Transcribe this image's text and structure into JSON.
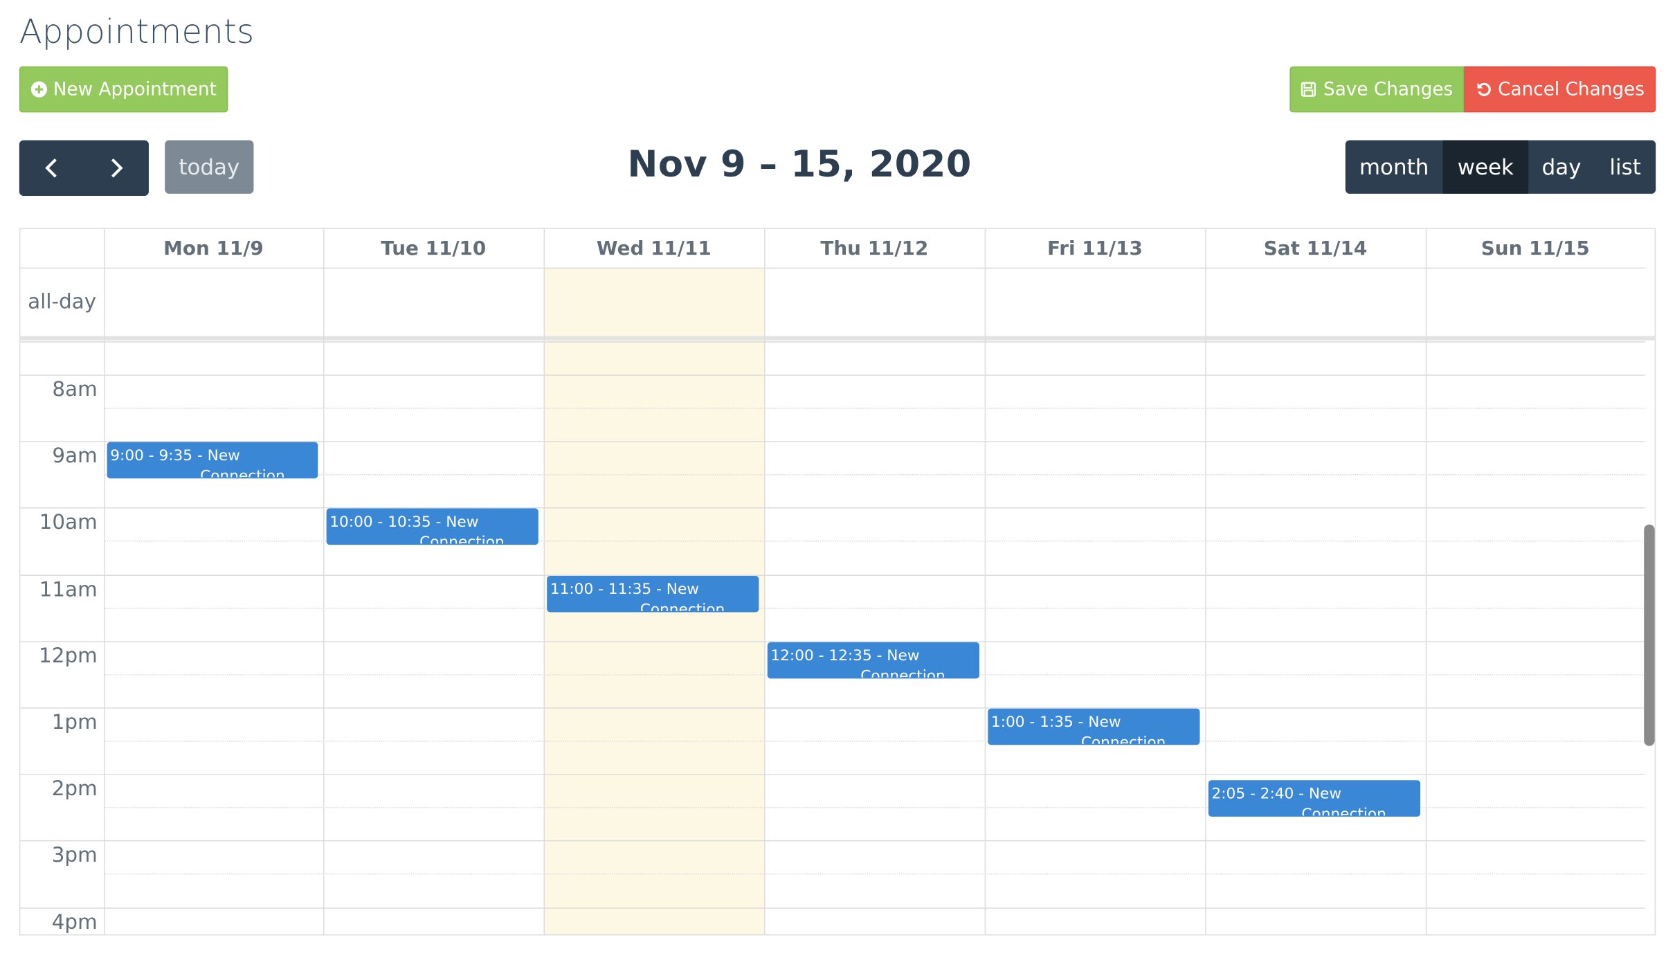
{
  "page": {
    "title": "Appointments"
  },
  "toolbar": {
    "new_label": "New Appointment",
    "save_label": "Save Changes",
    "cancel_label": "Cancel Changes",
    "today_label": "today",
    "range": "Nov 9 – 15, 2020",
    "views": [
      "month",
      "week",
      "day",
      "list"
    ],
    "active_view": "week"
  },
  "calendar": {
    "days": [
      "Mon 11/9",
      "Tue 11/10",
      "Wed 11/11",
      "Thu 11/12",
      "Fri 11/13",
      "Sat 11/14",
      "Sun 11/15"
    ],
    "today_index": 2,
    "allday_label": "all-day",
    "hours": [
      "8am",
      "9am",
      "10am",
      "11am",
      "12pm",
      "1pm",
      "2pm",
      "3pm",
      "4pm"
    ],
    "events": [
      {
        "day": 0,
        "time": "9:00 - 9:35",
        "title": "New Connection"
      },
      {
        "day": 1,
        "time": "10:00 - 10:35",
        "title": "New Connection"
      },
      {
        "day": 2,
        "time": "11:00 - 11:35",
        "title": "New Connection"
      },
      {
        "day": 3,
        "time": "12:00 - 12:35",
        "title": "New Connection"
      },
      {
        "day": 4,
        "time": "1:00 - 1:35",
        "title": "New Connection"
      },
      {
        "day": 5,
        "time": "2:05 - 2:40",
        "title": "New Connection"
      }
    ]
  },
  "colors": {
    "green": "#94c95e",
    "red": "#ec5a4c",
    "dark": "#2c3e50",
    "event": "#3a87d6",
    "today_bg": "#fcf8e3"
  }
}
